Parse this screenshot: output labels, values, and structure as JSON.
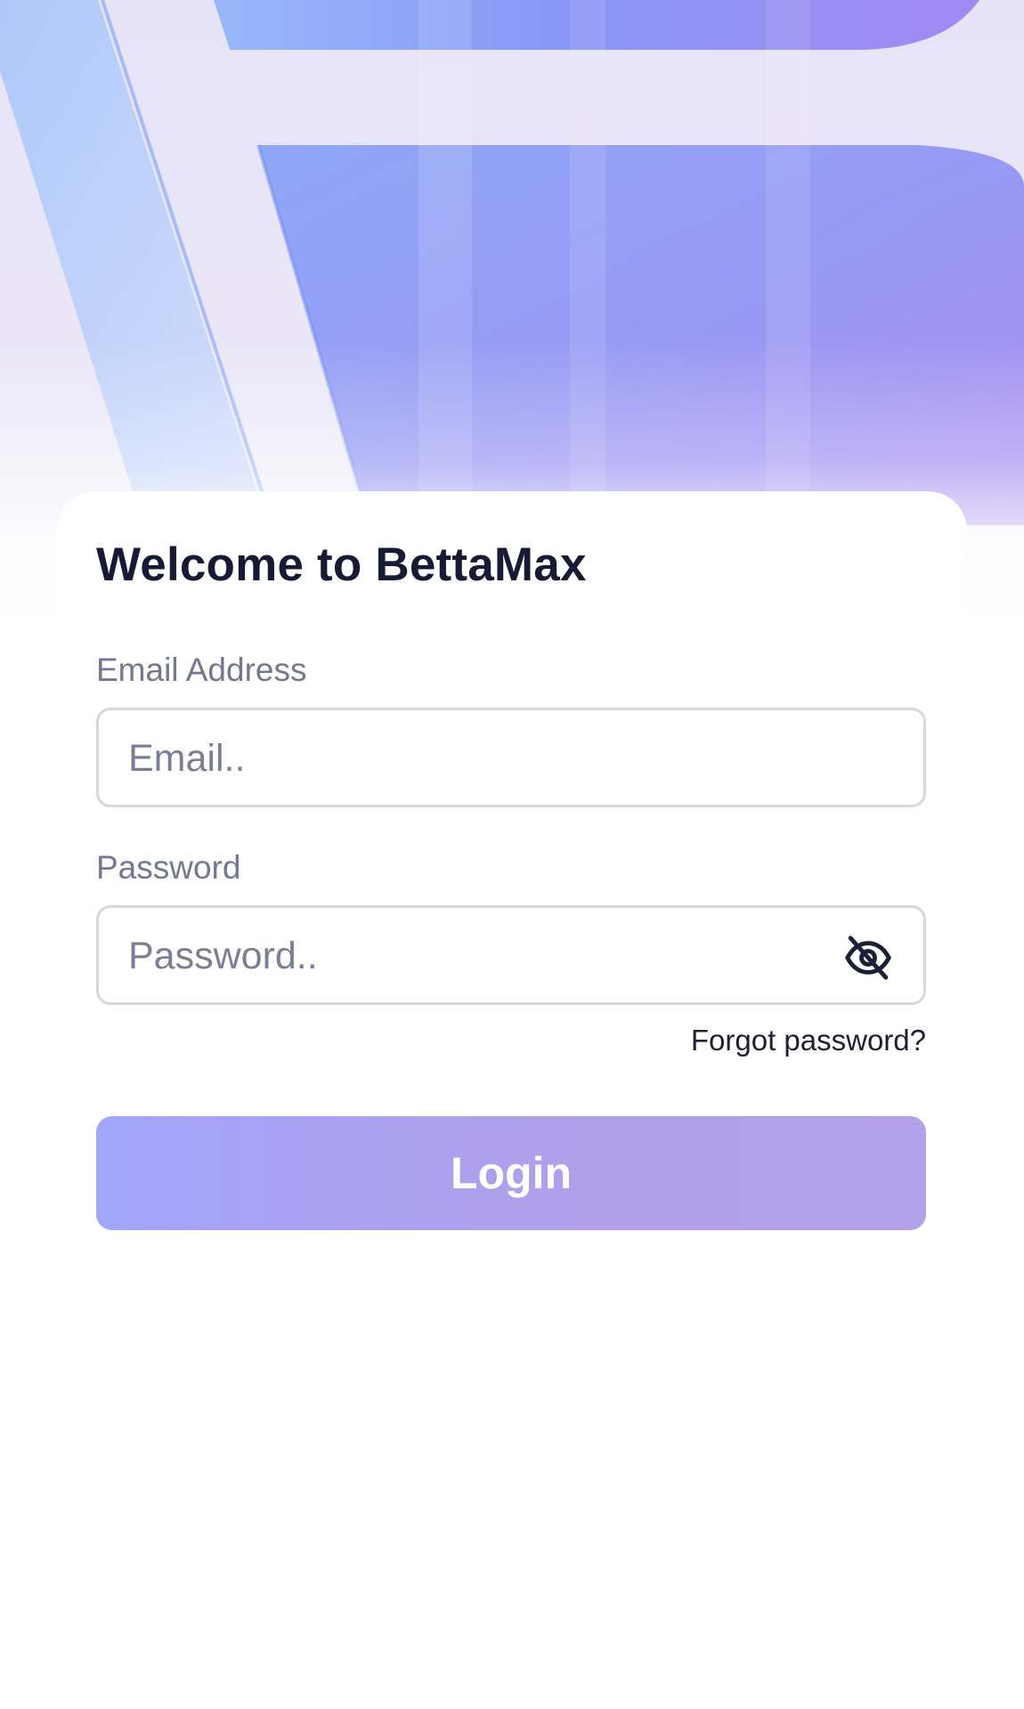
{
  "login": {
    "title": "Welcome to BettaMax",
    "email_label": "Email Address",
    "email_placeholder": "Email..",
    "email_value": "",
    "password_label": "Password",
    "password_placeholder": "Password..",
    "password_value": "",
    "toggle_icon": "eye-off-icon",
    "forgot_label": "Forgot password?",
    "login_label": "Login"
  },
  "colors": {
    "accent_start": "#a2a6fb",
    "accent_end": "#b3a0e9",
    "title": "#161a33",
    "label": "#737891",
    "border": "#d6d8de"
  }
}
